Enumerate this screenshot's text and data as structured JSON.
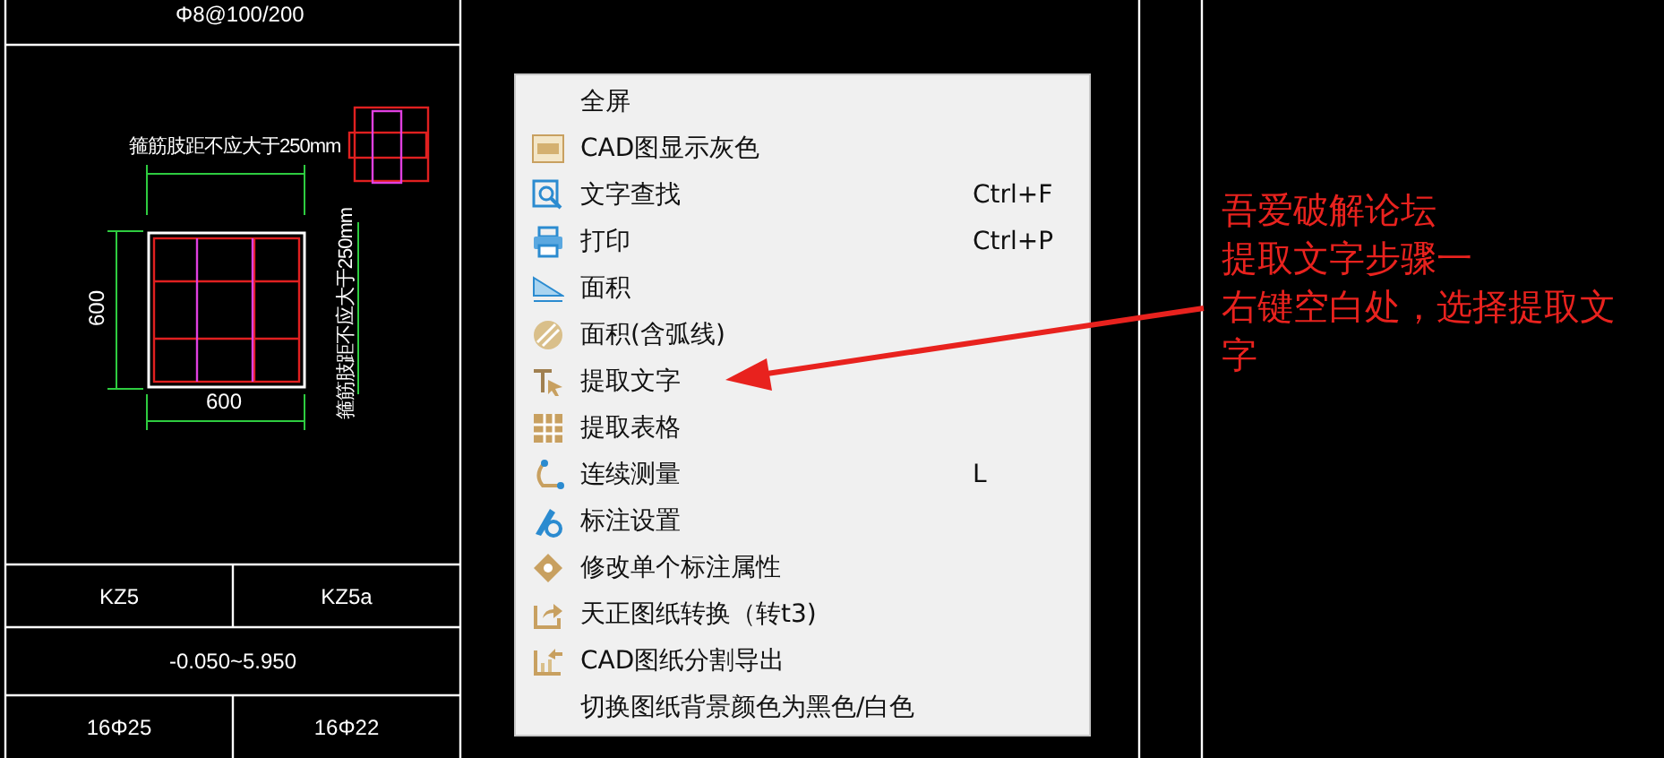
{
  "drawing": {
    "stirrup_note": "Φ8@100/200",
    "top_note": "箍筋肢距不应大于250mm",
    "side_note": "箍筋肢距不应大于250mm",
    "height_dim": "600",
    "width_dim": "600"
  },
  "table": {
    "rows": [
      [
        "KZ5",
        "KZ5a"
      ],
      [
        "-0.050~5.950"
      ],
      [
        "16Φ25",
        "16Φ22"
      ]
    ]
  },
  "context_menu": {
    "items": [
      {
        "label": "全屏",
        "kind": "none"
      },
      {
        "label": "CAD图显示灰色",
        "kind": "cad"
      },
      {
        "label": "文字查找",
        "shortcut": "Ctrl+F",
        "kind": "search"
      },
      {
        "label": "打印",
        "shortcut": "Ctrl+P",
        "kind": "print"
      },
      {
        "label": "面积",
        "kind": "area"
      },
      {
        "label": "面积(含弧线)",
        "kind": "area-arc"
      },
      {
        "label": "提取文字",
        "kind": "text-extract"
      },
      {
        "label": "提取表格",
        "kind": "table"
      },
      {
        "label": "连续测量",
        "shortcut": "L",
        "kind": "measure"
      },
      {
        "label": "标注设置",
        "kind": "annotate"
      },
      {
        "label": "修改单个标注属性",
        "kind": "edit-annotate"
      },
      {
        "label": "天正图纸转换（转t3)",
        "kind": "export"
      },
      {
        "label": "CAD图纸分割导出",
        "kind": "export-split"
      },
      {
        "label": "切换图纸背景颜色为黑色/白色",
        "kind": "none"
      }
    ]
  },
  "annotation": {
    "lines": [
      "吾爱破解论坛",
      "提取文字步骤一",
      "右键空白处，选择提取文字"
    ]
  }
}
